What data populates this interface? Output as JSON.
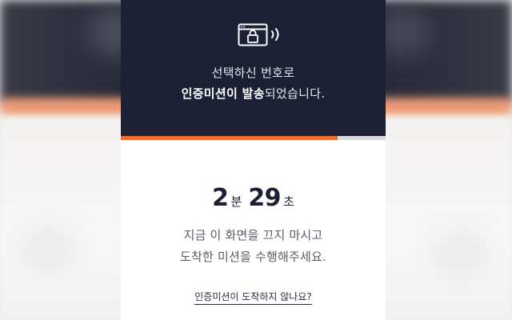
{
  "header": {
    "line1": "선택하신 번호로",
    "line2_bold": "인증미션이 발송",
    "line2_rest": "되었습니다."
  },
  "progress": {
    "fraction": 0.82
  },
  "timer": {
    "minutes": "2",
    "minutes_unit": "분",
    "seconds": "29",
    "seconds_unit": "초"
  },
  "description": {
    "line1": "지금 이 화면을 끄지 마시고",
    "line2": "도착한 미션을 수행해주세요."
  },
  "help_link": "인증미션이 도착하지 않나요?",
  "colors": {
    "header_bg": "#1c2035",
    "accent": "#ee6c2d"
  },
  "icons": {
    "header_icon": "browser-lock-wireless-icon"
  }
}
